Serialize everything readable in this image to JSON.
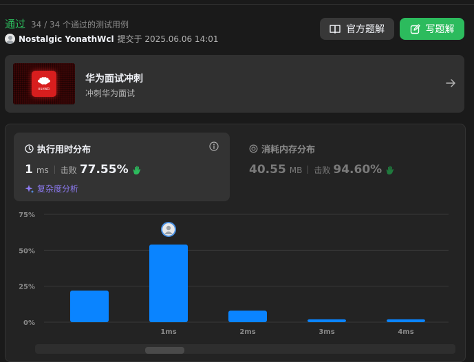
{
  "result": {
    "status": "通过",
    "passed_text": "34 / 34 个通过的测试用例"
  },
  "submission": {
    "author": "Nostalgic YonathWcl",
    "submitted_text": "提交于 2025.06.06 14:01"
  },
  "buttons": {
    "official_solution": "官方题解",
    "write_solution": "写题解"
  },
  "promo": {
    "title": "华为面试冲刺",
    "subtitle": "冲刺华为面试",
    "logo_text": "HUAWEI"
  },
  "runtime": {
    "title": "执行用时分布",
    "value": "1",
    "unit": "ms",
    "beat_label": "击败",
    "beat_value": "77.55%",
    "complexity_link": "复杂度分析"
  },
  "memory": {
    "title": "消耗内存分布",
    "value": "40.55",
    "unit": "MB",
    "beat_label": "击败",
    "beat_value": "94.60%"
  },
  "colors": {
    "accent_green": "#2cbb5d",
    "bar_blue": "#0a84ff",
    "complexity_purple": "#8e7bf4"
  },
  "chart_data": {
    "type": "bar",
    "categories": [
      "",
      "1ms",
      "2ms",
      "3ms",
      "4ms"
    ],
    "values": [
      22,
      54,
      8,
      2,
      2
    ],
    "yticks": [
      "75%",
      "50%",
      "25%",
      "0%"
    ],
    "ylim": [
      0,
      75
    ],
    "highlight_index": 1,
    "grid": true
  }
}
